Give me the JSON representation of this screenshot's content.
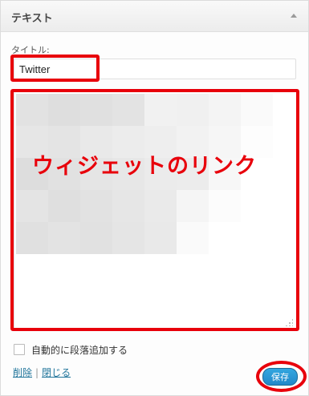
{
  "widget": {
    "title": "テキスト",
    "title_label": "タイトル:",
    "title_value": "Twitter",
    "content_overlay": "ウィジェットのリンク",
    "autop_label": "自動的に段落追加する",
    "autop_checked": false,
    "delete_label": "削除",
    "separator": "|",
    "close_label": "閉じる",
    "save_label": "保存"
  },
  "colors": {
    "annotation_red": "#e8000b",
    "link_blue": "#21759b",
    "button_blue": "#2a97d6"
  },
  "icons": {
    "toggle": "triangle-up-icon",
    "resize": "resize-grip-icon"
  }
}
